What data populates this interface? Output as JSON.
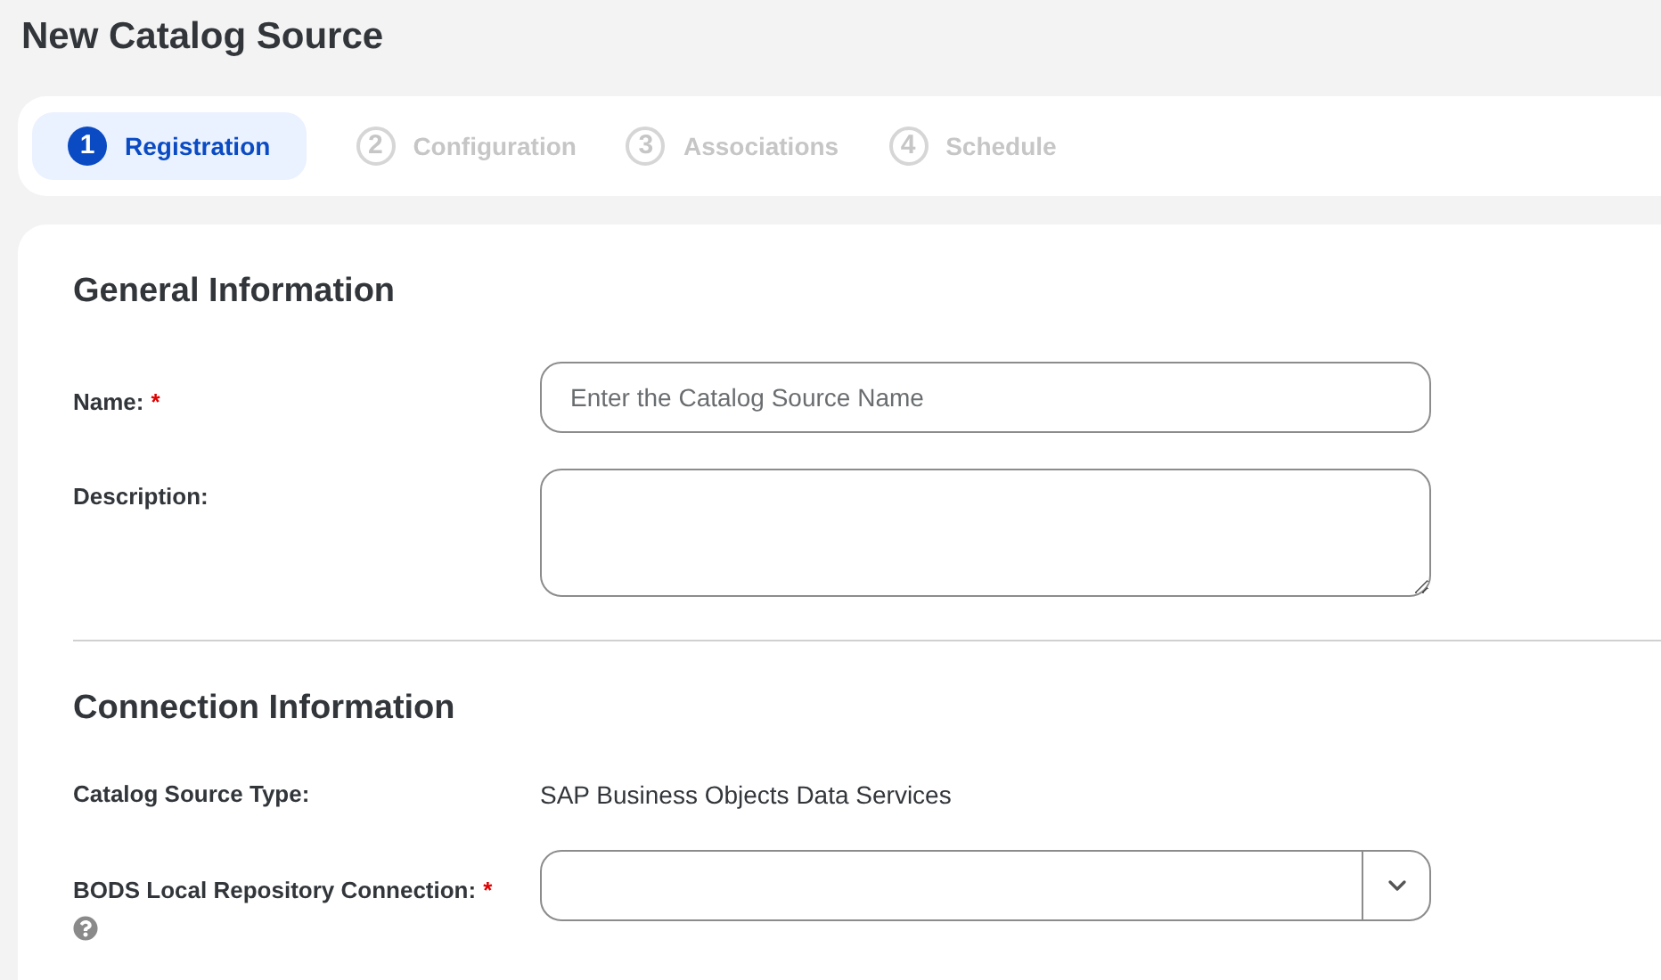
{
  "page_title": "New Catalog Source",
  "steps": [
    {
      "number": "1",
      "label": "Registration",
      "selected": true
    },
    {
      "number": "2",
      "label": "Configuration",
      "selected": false
    },
    {
      "number": "3",
      "label": "Associations",
      "selected": false
    },
    {
      "number": "4",
      "label": "Schedule",
      "selected": false
    }
  ],
  "sections": [
    {
      "heading": "General Information",
      "fields": [
        {
          "kind": "text",
          "label": "Name:",
          "required_mark": "*",
          "placeholder": "Enter the Catalog Source Name"
        },
        {
          "kind": "textarea",
          "label": "Description:"
        }
      ]
    },
    {
      "heading": "Connection Information",
      "fields": [
        {
          "kind": "static",
          "label": "Catalog Source Type:",
          "value": "SAP Business Objects Data Services"
        },
        {
          "kind": "select",
          "label": "BODS Local Repository Connection:",
          "required_mark": "*",
          "help": true
        }
      ]
    }
  ]
}
